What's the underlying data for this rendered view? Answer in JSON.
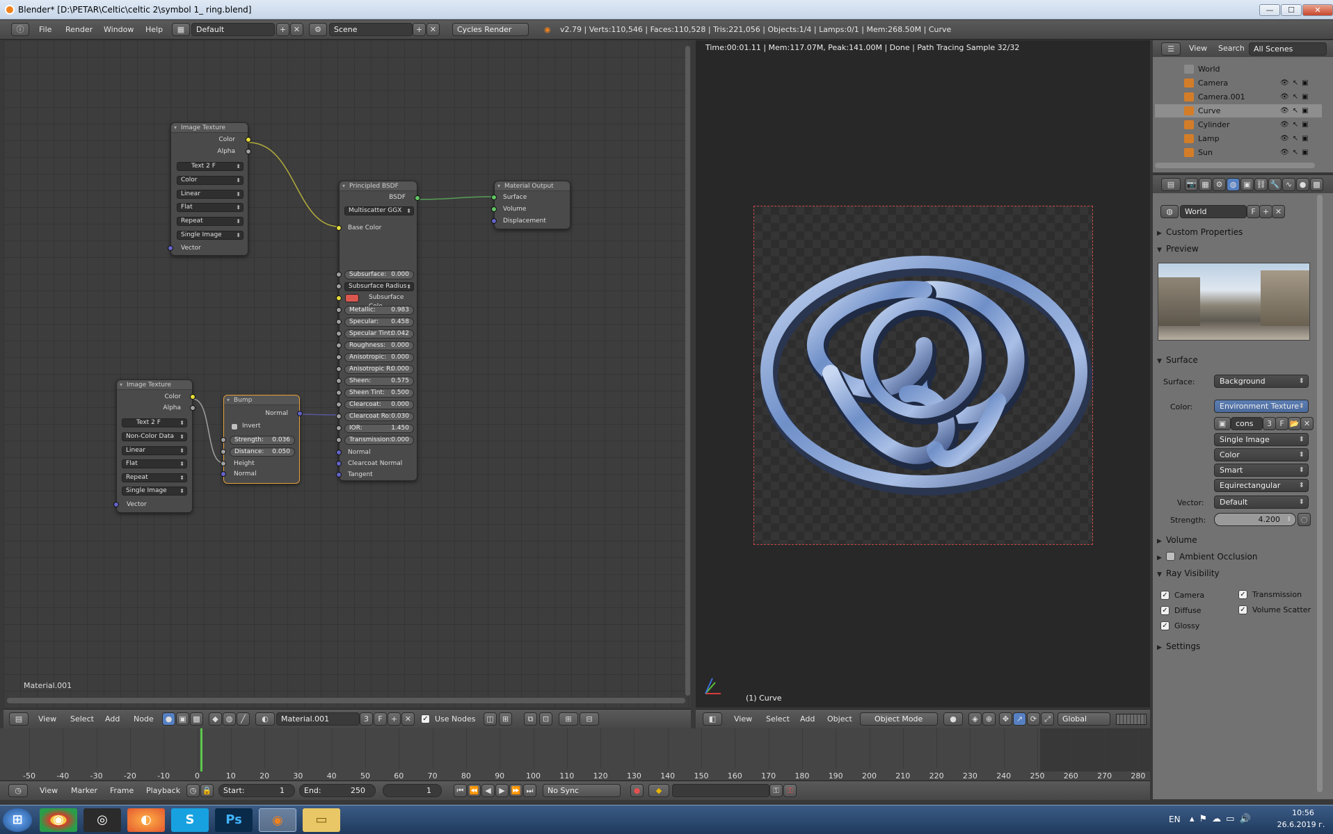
{
  "window": {
    "title": "Blender* [D:\\PETAR\\Celtic\\celtic 2\\symbol 1_ ring.blend]",
    "minimize": "—",
    "maximize": "☐",
    "close": "✕"
  },
  "topbar": {
    "menus": [
      "File",
      "Render",
      "Window",
      "Help"
    ],
    "layout": "Default",
    "scene": "Scene",
    "engine": "Cycles Render",
    "stats": "v2.79 | Verts:110,546 | Faces:110,528 | Tris:221,056 | Objects:1/4 | Lamps:0/1 | Mem:268.50M | Curve"
  },
  "nodes": {
    "img1": {
      "title": "Image Texture",
      "out_color": "Color",
      "out_alpha": "Alpha",
      "image": "Text",
      "users": "2",
      "fake": "F",
      "color": "Color",
      "interp": "Linear",
      "proj": "Flat",
      "ext": "Repeat",
      "source": "Single Image",
      "vector": "Vector"
    },
    "img2": {
      "title": "Image Texture",
      "out_color": "Color",
      "out_alpha": "Alpha",
      "image": "Text",
      "users": "2",
      "fake": "F",
      "color": "Non-Color Data",
      "interp": "Linear",
      "proj": "Flat",
      "ext": "Repeat",
      "source": "Single Image",
      "vector": "Vector"
    },
    "bump": {
      "title": "Bump",
      "out_normal": "Normal",
      "invert": "Invert",
      "strength_label": "Strength:",
      "strength": "0.036",
      "distance_label": "Distance:",
      "distance": "0.050",
      "height": "Height",
      "normal": "Normal"
    },
    "bsdf": {
      "title": "Principled BSDF",
      "out": "BSDF",
      "dist": "Multiscatter GGX",
      "base": "Base Color",
      "ss_radius": "Subsurface Radius",
      "ss_color": "Subsurface Colo",
      "normal": "Normal",
      "cc_normal": "Clearcoat Normal",
      "tangent": "Tangent",
      "fields": [
        [
          "Subsurface:",
          "0.000"
        ],
        [
          "Metallic:",
          "0.983"
        ],
        [
          "Specular:",
          "0.458"
        ],
        [
          "Specular Tint:",
          "0.042"
        ],
        [
          "Roughness:",
          "0.000"
        ],
        [
          "Anisotropic:",
          "0.000"
        ],
        [
          "Anisotropic R:",
          "0.000"
        ],
        [
          "Sheen:",
          "0.575"
        ],
        [
          "Sheen Tint:",
          "0.500"
        ],
        [
          "Clearcoat:",
          "0.000"
        ],
        [
          "Clearcoat Ro:",
          "0.030"
        ],
        [
          "IOR:",
          "1.450"
        ],
        [
          "Transmission:",
          "0.000"
        ]
      ]
    },
    "output": {
      "title": "Material Output",
      "surface": "Surface",
      "volume": "Volume",
      "displacement": "Displacement"
    }
  },
  "node_editor": {
    "material_label": "Material.001",
    "header": {
      "menus": [
        "View",
        "Select",
        "Add",
        "Node"
      ],
      "material": "Material.001",
      "users": "3",
      "fake": "F",
      "use_nodes": "Use Nodes"
    }
  },
  "viewport": {
    "render_info": "Time:00:01.11 | Mem:117.07M, Peak:141.00M | Done | Path Tracing Sample 32/32",
    "object_label": "(1) Curve",
    "header": {
      "menus": [
        "View",
        "Select",
        "Add",
        "Object"
      ],
      "mode": "Object Mode",
      "orientation": "Global"
    }
  },
  "outliner": {
    "tabs": [
      "View",
      "Search"
    ],
    "scope": "All Scenes",
    "items": [
      {
        "name": "World",
        "icon": "world-icon",
        "color": "#8a8a8a"
      },
      {
        "name": "Camera",
        "icon": "camera-icon",
        "color": "#d47d28"
      },
      {
        "name": "Camera.001",
        "icon": "camera-icon",
        "color": "#d47d28"
      },
      {
        "name": "Curve",
        "icon": "curve-icon",
        "color": "#d47d28"
      },
      {
        "name": "Cylinder",
        "icon": "mesh-icon",
        "color": "#d47d28"
      },
      {
        "name": "Lamp",
        "icon": "lamp-icon",
        "color": "#d47d28"
      },
      {
        "name": "Sun",
        "icon": "lamp-icon",
        "color": "#d47d28"
      }
    ]
  },
  "properties": {
    "world_name": "World",
    "fake": "F",
    "sections": {
      "custom": "Custom Properties",
      "preview": "Preview",
      "surface": "Surface",
      "volume": "Volume",
      "ao": "Ambient Occlusion",
      "ray": "Ray Visibility",
      "settings": "Settings"
    },
    "surface_label": "Surface:",
    "surface_value": "Background",
    "color_label": "Color:",
    "color_value": "Environment Texture",
    "image_name": "cons",
    "image_users": "3",
    "image_fake": "F",
    "source": "Single Image",
    "color_space": "Color",
    "interp": "Smart",
    "projection": "Equirectangular",
    "vector_label": "Vector:",
    "vector_value": "Default",
    "strength_label": "Strength:",
    "strength_value": "4.200",
    "ray": {
      "camera": "Camera",
      "transmission": "Transmission",
      "diffuse": "Diffuse",
      "volume_scatter": "Volume Scatter",
      "glossy": "Glossy"
    }
  },
  "timeline": {
    "ticks": [
      "-50",
      "-40",
      "-30",
      "-20",
      "-10",
      "0",
      "10",
      "20",
      "30",
      "40",
      "50",
      "60",
      "70",
      "80",
      "90",
      "100",
      "110",
      "120",
      "130",
      "140",
      "150",
      "160",
      "170",
      "180",
      "190",
      "200",
      "210",
      "220",
      "230",
      "240",
      "250",
      "260",
      "270",
      "280"
    ],
    "menus": [
      "View",
      "Marker",
      "Frame",
      "Playback"
    ],
    "start_label": "Start:",
    "start": "1",
    "end_label": "End:",
    "end": "250",
    "current": "1",
    "sync": "No Sync"
  },
  "taskbar": {
    "lang": "EN",
    "time": "10:56",
    "date": "26.6.2019 г."
  }
}
